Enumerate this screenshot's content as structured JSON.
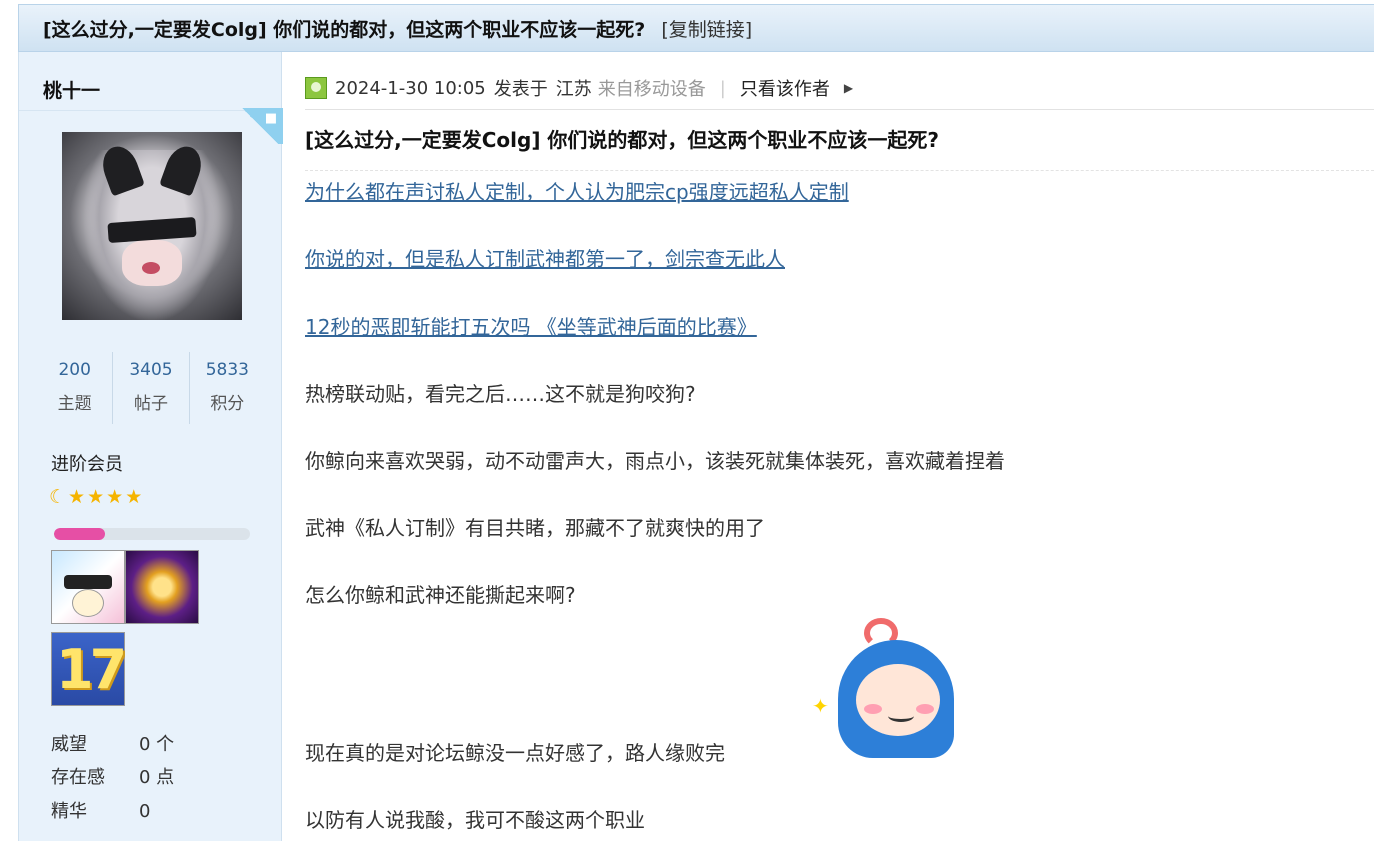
{
  "thread": {
    "title": "[这么过分,一定要发Colg] 你们说的都对，但这两个职业不应该一起死?",
    "copy_link": "[复制链接]"
  },
  "user": {
    "name": "桃十一",
    "stats": [
      {
        "value": "200",
        "label": "主题"
      },
      {
        "value": "3405",
        "label": "帖子"
      },
      {
        "value": "5833",
        "label": "积分"
      }
    ],
    "rank": "进阶会员",
    "level_progress_percent": 26,
    "medal_number": "17",
    "info": [
      {
        "key": "威望",
        "value": "0 个"
      },
      {
        "key": "存在感",
        "value": "0 点"
      },
      {
        "key": "精华",
        "value": "0"
      }
    ]
  },
  "post": {
    "date": "2024-1-30 10:05",
    "posted_at": "发表于",
    "location": "江苏",
    "device": "来自移动设备",
    "divider": "|",
    "only_author": "只看该作者",
    "title": "[这么过分,一定要发Colg] 你们说的都对，但这两个职业不应该一起死?",
    "links": [
      "为什么都在声讨私人定制，个人认为肥宗cp强度远超私人定制",
      "你说的对，但是私人订制武神都第一了，剑宗查无此人",
      "12秒的恶即斩能打五次吗 《坐等武神后面的比赛》"
    ],
    "paragraphs": [
      "热榜联动贴，看完之后……这不就是狗咬狗?",
      "你鲸向来喜欢哭弱，动不动雷声大，雨点小，该装死就集体装死，喜欢藏着捏着",
      "武神《私人订制》有目共睹，那藏不了就爽快的用了",
      "怎么你鲸和武神还能撕起来啊?",
      "现在真的是对论坛鲸没一点好感了，路人缘败完",
      "以防有人说我酸，我可不酸这两个职业"
    ]
  },
  "icons": {
    "android": "android-icon",
    "arrow": "triangle-right-icon",
    "star": "star-icon",
    "moon": "moon-icon"
  },
  "colors": {
    "link": "#336699",
    "sidebar_bg": "#e8f2fb",
    "progress": "#e64fa5"
  }
}
